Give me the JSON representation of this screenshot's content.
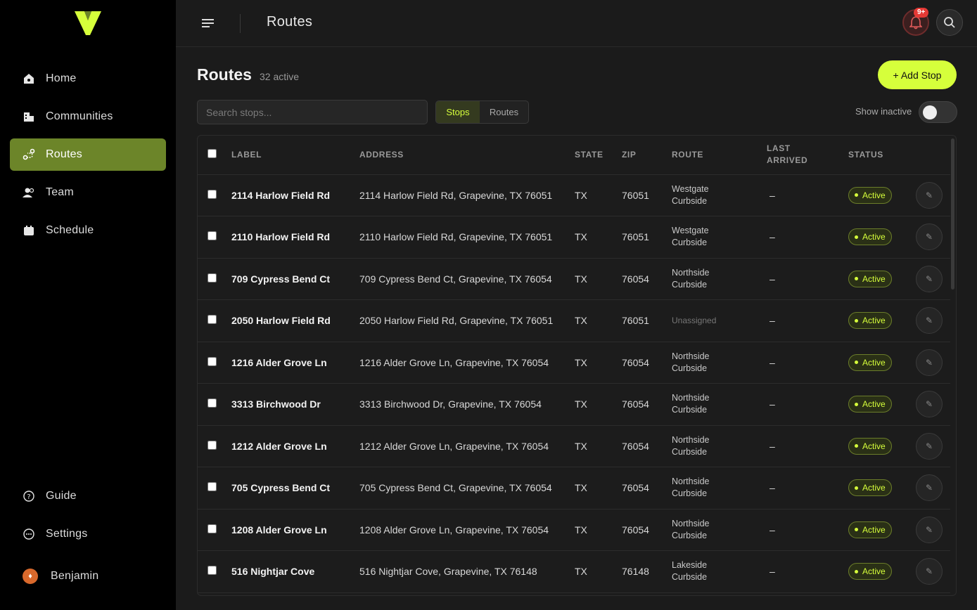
{
  "sidebar": {
    "logo": "V",
    "nav": [
      {
        "label": "Home",
        "icon": "home-icon"
      },
      {
        "label": "Communities",
        "icon": "buildings-icon"
      },
      {
        "label": "Routes",
        "icon": "route-icon",
        "active": true
      },
      {
        "label": "Team",
        "icon": "team-icon"
      },
      {
        "label": "Schedule",
        "icon": "calendar-icon"
      }
    ],
    "bottom": [
      {
        "label": "Guide",
        "icon": "help-icon"
      },
      {
        "label": "Settings",
        "icon": "settings-icon"
      }
    ],
    "user": {
      "name": "Benjamin"
    }
  },
  "topbar": {
    "title": "Routes",
    "notifications_badge": "9+"
  },
  "main": {
    "title": "Routes",
    "active_count": "32 active",
    "add_button": "+ Add Stop",
    "search_placeholder": "Search stops...",
    "tabs": [
      "Stops",
      "Routes"
    ],
    "show_inactive_label": "Show inactive",
    "show_inactive": false
  },
  "table": {
    "columns": [
      "LABEL",
      "ADDRESS",
      "STATE",
      "ZIP",
      "ROUTE",
      "LAST ARRIVED",
      "STATUS"
    ],
    "rows": [
      {
        "label": "2114 Harlow Field Rd",
        "address": "2114 Harlow Field Rd, Grapevine, TX 76051",
        "state": "TX",
        "zip": "76051",
        "route": "Westgate Curbside",
        "last": "–",
        "status": "Active"
      },
      {
        "label": "2110 Harlow Field Rd",
        "address": "2110 Harlow Field Rd, Grapevine, TX 76051",
        "state": "TX",
        "zip": "76051",
        "route": "Westgate Curbside",
        "last": "–",
        "status": "Active"
      },
      {
        "label": "709 Cypress Bend Ct",
        "address": "709 Cypress Bend Ct, Grapevine, TX 76054",
        "state": "TX",
        "zip": "76054",
        "route": "Northside Curbside",
        "last": "–",
        "status": "Active"
      },
      {
        "label": "2050 Harlow Field Rd",
        "address": "2050 Harlow Field Rd, Grapevine, TX 76051",
        "state": "TX",
        "zip": "76051",
        "route": "Unassigned",
        "last": "–",
        "status": "Active"
      },
      {
        "label": "1216 Alder Grove Ln",
        "address": "1216 Alder Grove Ln, Grapevine, TX 76054",
        "state": "TX",
        "zip": "76054",
        "route": "Northside Curbside",
        "last": "–",
        "status": "Active"
      },
      {
        "label": "3313 Birchwood Dr",
        "address": "3313 Birchwood Dr, Grapevine, TX 76054",
        "state": "TX",
        "zip": "76054",
        "route": "Northside Curbside",
        "last": "–",
        "status": "Active"
      },
      {
        "label": "1212 Alder Grove Ln",
        "address": "1212 Alder Grove Ln, Grapevine, TX 76054",
        "state": "TX",
        "zip": "76054",
        "route": "Northside Curbside",
        "last": "–",
        "status": "Active"
      },
      {
        "label": "705 Cypress Bend Ct",
        "address": "705 Cypress Bend Ct, Grapevine, TX 76054",
        "state": "TX",
        "zip": "76054",
        "route": "Northside Curbside",
        "last": "–",
        "status": "Active"
      },
      {
        "label": "1208 Alder Grove Ln",
        "address": "1208 Alder Grove Ln, Grapevine, TX 76054",
        "state": "TX",
        "zip": "76054",
        "route": "Northside Curbside",
        "last": "–",
        "status": "Active"
      },
      {
        "label": "516 Nightjar Cove",
        "address": "516 Nightjar Cove, Grapevine, TX 76148",
        "state": "TX",
        "zip": "76148",
        "route": "Lakeside Curbside",
        "last": "–",
        "status": "Active"
      }
    ]
  },
  "colors": {
    "accent": "#d6ff3b",
    "active_nav": "#6c8529",
    "sidebar_bg": "#000000",
    "page_bg": "#1b1b1b",
    "alert": "#e53935"
  }
}
